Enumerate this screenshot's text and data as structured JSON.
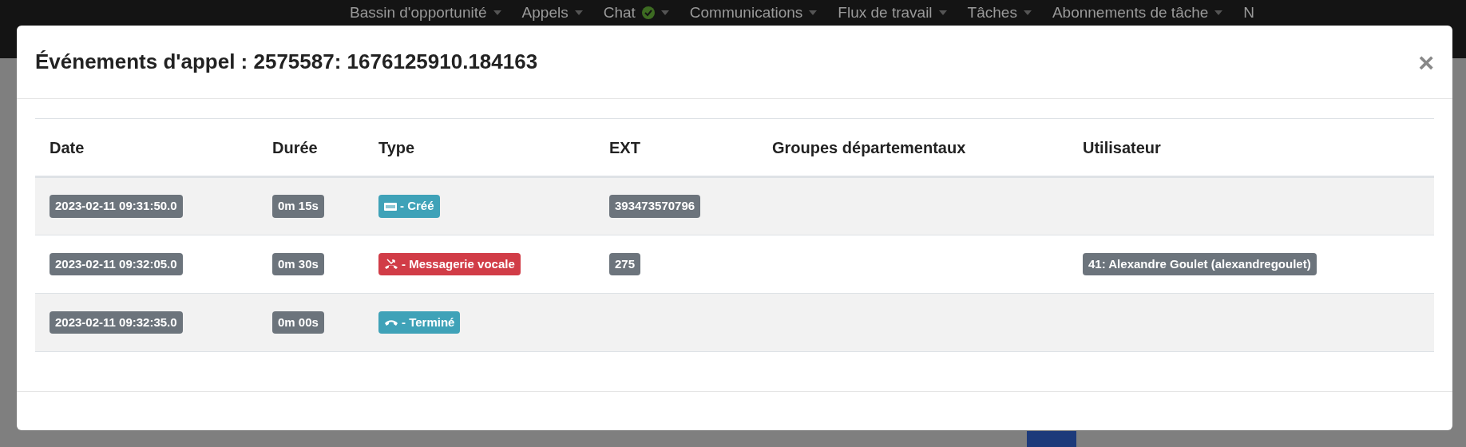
{
  "nav": {
    "items": [
      {
        "label": "Bassin d'opportunité",
        "status": false
      },
      {
        "label": "Appels",
        "status": false
      },
      {
        "label": "Chat",
        "status": true
      },
      {
        "label": "Communications",
        "status": false
      },
      {
        "label": "Flux de travail",
        "status": false
      },
      {
        "label": "Tâches",
        "status": false
      },
      {
        "label": "Abonnements de tâche",
        "status": false
      }
    ],
    "cut_item": "N"
  },
  "modal": {
    "title": "Événements d'appel : 2575587: 1676125910.184163",
    "close": "×",
    "table": {
      "columns": [
        "Date",
        "Durée",
        "Type",
        "EXT",
        "Groupes départementaux",
        "Utilisateur"
      ],
      "rows": [
        {
          "date": "2023-02-11 09:31:50.0",
          "duration": "0m 15s",
          "type": {
            "kind": "created",
            "label": "- Créé"
          },
          "ext": "393473570796"
        },
        {
          "date": "2023-02-11 09:32:05.0",
          "duration": "0m 30s",
          "type": {
            "kind": "voicemail",
            "label": "- Messagerie vocale"
          },
          "ext": "275",
          "user": "41: Alexandre Goulet (alexandregoulet)"
        },
        {
          "date": "2023-02-11 09:32:35.0",
          "duration": "0m 00s",
          "type": {
            "kind": "ended",
            "label": "- Terminé"
          }
        }
      ]
    }
  }
}
